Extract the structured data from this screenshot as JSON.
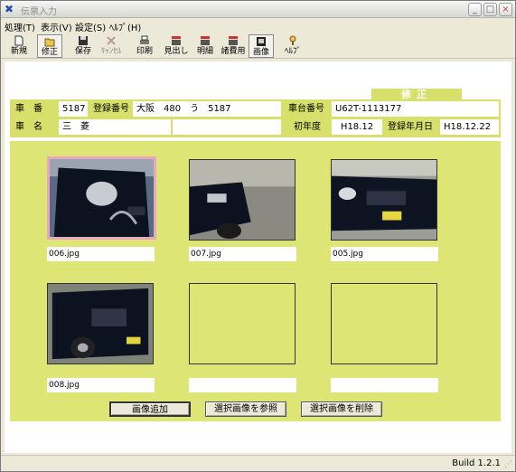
{
  "window": {
    "title": "伝票入力",
    "minimize": "_",
    "maximize": "□",
    "close": "×"
  },
  "menu": [
    "処理(T)",
    "表示(V)",
    "設定(S)",
    "ﾍﾙﾌﾟ(H)"
  ],
  "toolbar": {
    "new": "新規",
    "edit": "修正",
    "save": "保存",
    "cancel": "ｷｬﾝｾﾙ",
    "print": "印刷",
    "header": "見出し",
    "detail": "明細",
    "expenses": "諸費用",
    "image": "画像",
    "help": "ﾍﾙﾌﾟ"
  },
  "mode_label": "修正",
  "vehicle": {
    "number_label": "車　番",
    "number": "5187",
    "reg_no_label": "登録番号",
    "reg_no": "大阪　480　う　5187",
    "chassis_label": "車台番号",
    "chassis": "U62T-1113177",
    "name_label": "車　名",
    "name": "三　菱",
    "first_reg_label": "初年度",
    "first_reg": "H18.12",
    "reg_date_label": "登録年月日",
    "reg_date": "H18.12.22"
  },
  "photos": [
    {
      "file": "006.jpg",
      "has_image": true
    },
    {
      "file": "007.jpg",
      "has_image": true
    },
    {
      "file": "005.jpg",
      "has_image": true
    },
    {
      "file": "008.jpg",
      "has_image": true
    },
    {
      "file": "",
      "has_image": false
    },
    {
      "file": "",
      "has_image": false
    }
  ],
  "actions": {
    "add": "画像追加",
    "view": "選択画像を参照",
    "delete": "選択画像を削除"
  },
  "status": {
    "build": "Build 1.2.1"
  },
  "colors": {
    "panel": "#d7e06b",
    "selected_border": "#e8a7c0"
  },
  "icons": [
    "new-icon",
    "edit-icon",
    "save-icon",
    "cancel-icon",
    "print-icon",
    "header-icon",
    "detail-icon",
    "expenses-icon",
    "image-icon",
    "help-icon"
  ]
}
